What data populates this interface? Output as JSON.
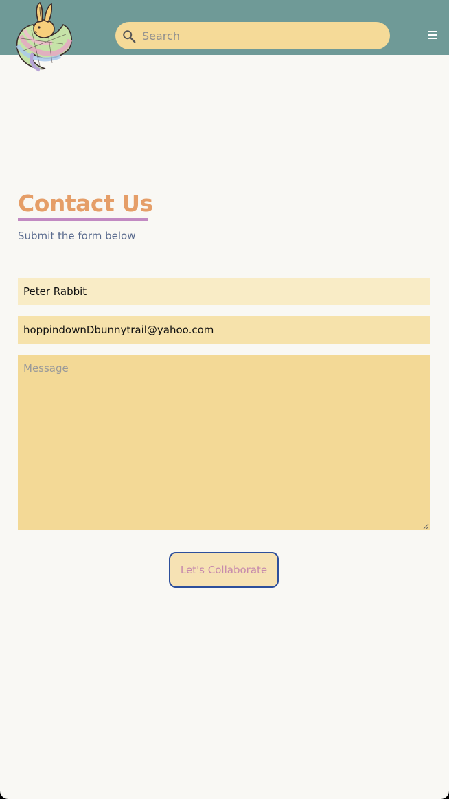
{
  "header": {
    "search": {
      "placeholder": "Search",
      "value": ""
    },
    "logo_icon": "bunny-scarf-logo",
    "menu_icon": "hamburger-menu-icon"
  },
  "contact": {
    "title": "Contact Us",
    "subtitle": "Submit the form below"
  },
  "form": {
    "name_value": "Peter Rabbit",
    "email_value": "hoppindownDbunnytrail@yahoo.com",
    "message_placeholder": "Message",
    "message_value": "",
    "submit_label": "Let's Collaborate"
  },
  "colors": {
    "header_bg": "#6f9a97",
    "search_bg": "#f5da98",
    "title": "#e59e68",
    "title_underline": "#c28ac2",
    "subtitle": "#5a6b8e",
    "button_border": "#2d4f9c",
    "button_text": "#c68aac"
  }
}
